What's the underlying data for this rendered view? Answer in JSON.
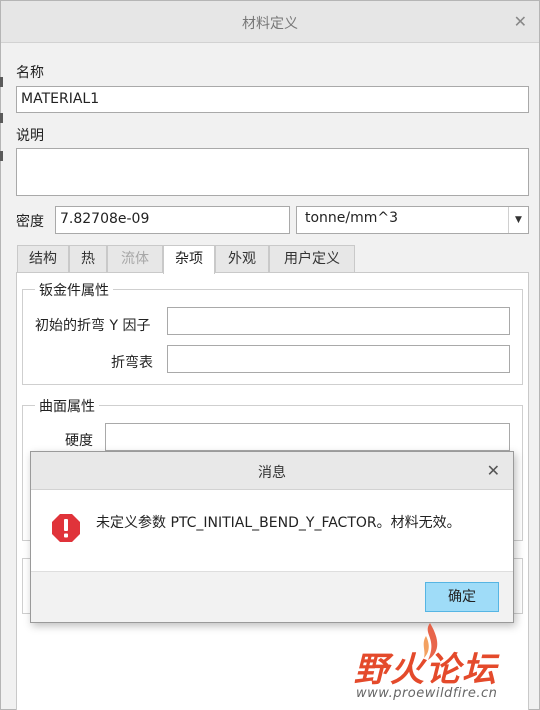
{
  "dialog": {
    "title": "材料定义",
    "close_glyph": "✕",
    "name_label": "名称",
    "name_value": "MATERIAL1",
    "description_label": "说明",
    "description_value": "",
    "density_label": "密度",
    "density_value": "7.82708e-09",
    "density_unit": "tonne/mm^3"
  },
  "tabs": [
    {
      "label": "结构",
      "state": "normal"
    },
    {
      "label": "热",
      "state": "normal"
    },
    {
      "label": "流体",
      "state": "disabled"
    },
    {
      "label": "杂项",
      "state": "active"
    },
    {
      "label": "外观",
      "state": "normal"
    },
    {
      "label": "用户定义",
      "state": "normal"
    }
  ],
  "sheetmetal": {
    "title": "钣金件属性",
    "y_factor_label": "初始的折弯 Y 因子",
    "y_factor_value": "",
    "bend_table_label": "折弯表",
    "bend_table_value": ""
  },
  "surface": {
    "title": "曲面属性",
    "hardness_label": "硬度",
    "hardness_value": ""
  },
  "message_dialog": {
    "title": "消息",
    "close_glyph": "✕",
    "icon": "error-icon",
    "message": "未定义参数 PTC_INITIAL_BEND_Y_FACTOR。材料无效。",
    "ok_label": "确定"
  },
  "watermark": {
    "brand": "野火论坛",
    "url": "www.proewildfire.cn"
  },
  "colors": {
    "accent_button": "#9fdcf8",
    "error_red": "#e0333a",
    "watermark_red": "#e44a2b"
  }
}
